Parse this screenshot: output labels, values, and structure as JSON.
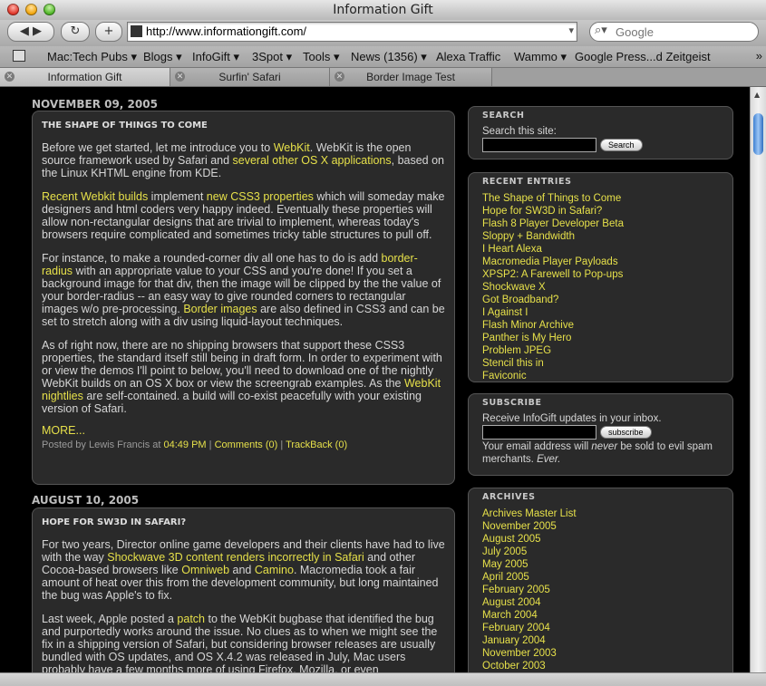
{
  "window": {
    "title": "Information Gift"
  },
  "toolbar": {
    "back_label": "◀ ▶",
    "reload_label": "↻",
    "add_label": "+",
    "url": "http://www.informationgift.com/",
    "search_placeholder": "Google"
  },
  "bookmarks": [
    {
      "label": "Mac:Tech Pubs ▾"
    },
    {
      "label": "Blogs ▾"
    },
    {
      "label": "InfoGift ▾"
    },
    {
      "label": "3Spot ▾"
    },
    {
      "label": "Tools ▾"
    },
    {
      "label": "News (1356) ▾"
    },
    {
      "label": "Alexa Traffic"
    },
    {
      "label": "Wammo ▾"
    },
    {
      "label": "Google Press...d Zeitgeist"
    }
  ],
  "bookmarks_more": "»",
  "tabs": [
    {
      "label": "Information Gift",
      "active": true
    },
    {
      "label": "Surfin' Safari",
      "active": false
    },
    {
      "label": "Border Image Test",
      "active": false
    }
  ],
  "posts": [
    {
      "date": "NOVEMBER 09, 2005",
      "title": "THE SHAPE OF THINGS TO COME",
      "p1_a": "Before we get started, let me introduce you to ",
      "p1_link1": "WebKit",
      "p1_b": ". WebKit is the open source framework used by Safari and ",
      "p1_link2": "several other OS X applications",
      "p1_c": ", based on the Linux KHTML engine from KDE.",
      "p2_link1": "Recent Webkit builds",
      "p2_a": " implement ",
      "p2_link2": "new CSS3 properties",
      "p2_b": " which will someday make designers and html coders very happy indeed. Eventually these properties will allow non-rectangular designs that are trivial to implement, whereas today's browsers require complicated and sometimes tricky table structures to pull off.",
      "p3_a": "For instance, to make a rounded-corner div all one has to do is add ",
      "p3_link1": "border-radius",
      "p3_b": " with an appropriate value to your CSS and you're done! If you set a background image for that div, then the image will be clipped by the the value of your border-radius -- an easy way to give rounded corners to rectangular images w/o pre-processing. ",
      "p3_link2": "Border images",
      "p3_c": " are also defined in CSS3 and can be set to stretch along with a div using liquid-layout techniques.",
      "p4_a": "As of right now, there are no shipping browsers that support these CSS3 properties, the standard itself still being in draft form. In order to experiment with or view the demos I'll point to below, you'll need to download one of the nightly WebKit builds on an OS X box or view the screengrab examples. As the ",
      "p4_link1": "WebKit nightlies",
      "p4_b": " are self-contained. a build will co-exist peacefully with your existing version of Safari.",
      "more": "MORE...",
      "meta_prefix": "Posted by Lewis Francis at ",
      "meta_time": "04:49 PM",
      "meta_sep1": " | ",
      "meta_comments": "Comments (0)",
      "meta_sep2": " | ",
      "meta_trackback": "TrackBack (0)"
    },
    {
      "date": "AUGUST 10, 2005",
      "title": "HOPE FOR SW3D IN SAFARI?",
      "p1_a": "For two years, Director online game developers and their clients have had to live with the way ",
      "p1_link1": "Shockwave 3D content renders incorrectly in Safari",
      "p1_b": " and other Cocoa-based browsers like ",
      "p1_link2": "Omniweb",
      "p1_c": " and ",
      "p1_link3": "Camino",
      "p1_d": ". Macromedia took a fair amount of heat over this from the development community, but long maintained the bug was Apple's to fix.",
      "p2_a": "Last week, Apple posted a ",
      "p2_link1": "patch",
      "p2_b": " to the WebKit bugbase that identified the bug and purportedly works around the issue. No clues as to when we might see the fix in a shipping version of Safari, but considering browser releases are usually bundled with OS updates, and OS X.4.2 was released in July, Mac users probably have a few months more of using Firefox, Mozilla, or even"
    }
  ],
  "sidebar": {
    "search": {
      "title": "SEARCH",
      "label": "Search this site:",
      "button": "Search"
    },
    "recent": {
      "title": "RECENT ENTRIES",
      "items": [
        "The Shape of Things to Come",
        "Hope for SW3D in Safari?",
        "Flash 8 Player Developer Beta",
        "Sloppy + Bandwidth",
        "I Heart Alexa",
        "Macromedia Player Payloads",
        "XPSP2: A Farewell to Pop-ups",
        "Shockwave X",
        "Got Broadband?",
        "I Against I",
        "Flash Minor Archive",
        "Panther is My Hero",
        "Problem JPEG",
        "Stencil this in",
        "Faviconic"
      ]
    },
    "subscribe": {
      "title": "SUBSCRIBE",
      "label": "Receive InfoGift updates in your inbox.",
      "button": "subscribe",
      "note_a": "Your email address will ",
      "note_em": "never",
      "note_b": " be sold to evil spam merchants. ",
      "note_em2": "Ever."
    },
    "archives": {
      "title": "ARCHIVES",
      "items": [
        "Archives Master List",
        "November 2005",
        "August 2005",
        "July 2005",
        "May 2005",
        "April 2005",
        "February 2005",
        "August 2004",
        "March 2004",
        "February 2004",
        "January 2004",
        "November 2003",
        "October 2003"
      ]
    }
  }
}
